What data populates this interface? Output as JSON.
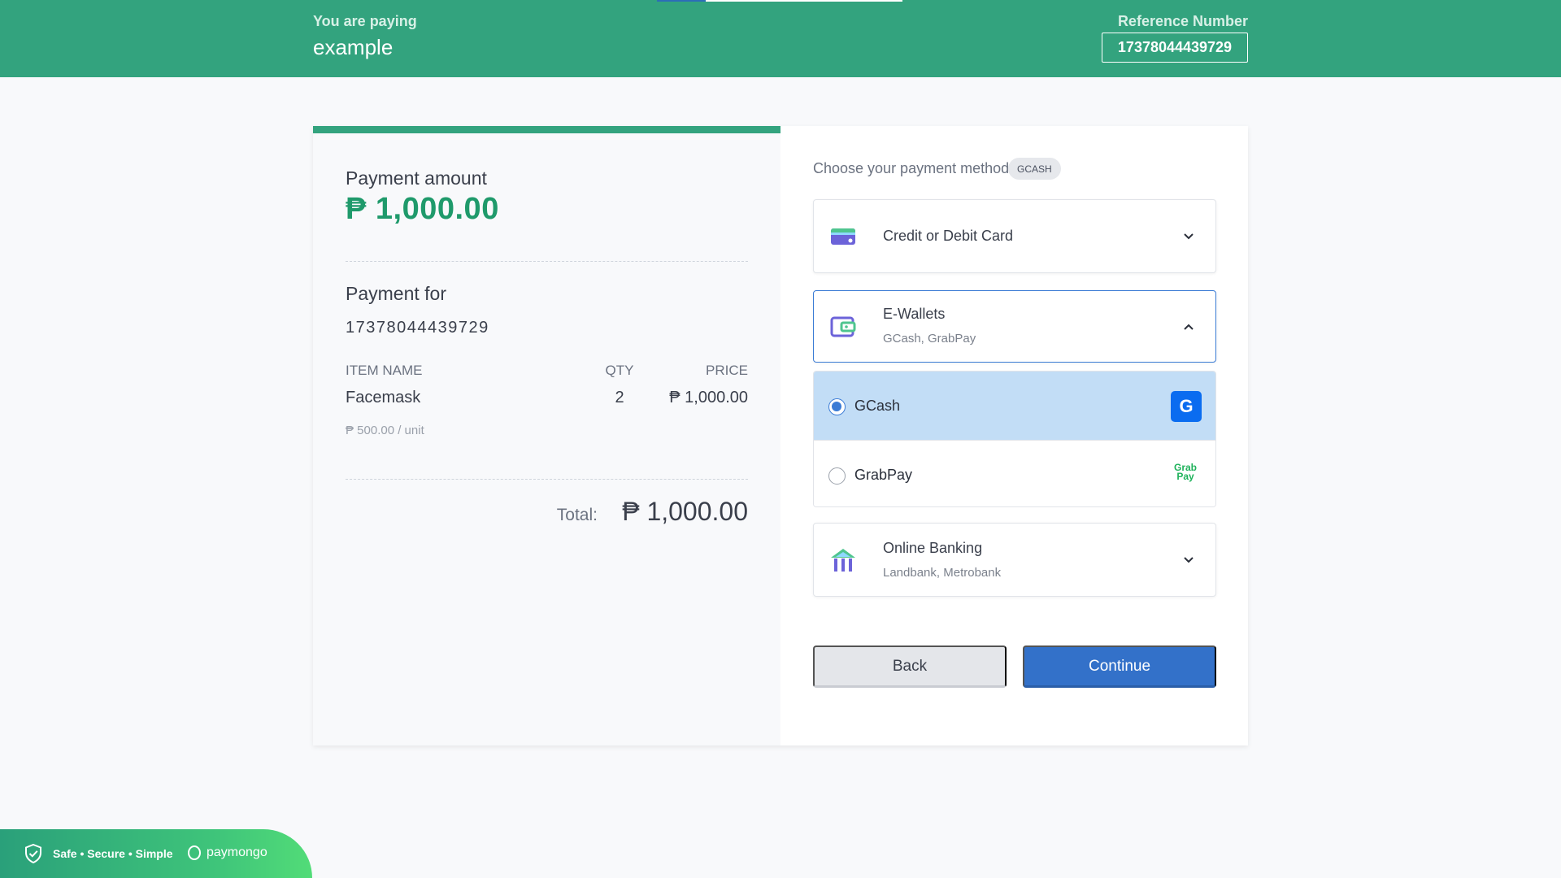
{
  "header": {
    "paying_label": "You are paying",
    "merchant": "example",
    "reference_label": "Reference Number",
    "reference_number": "17378044439729"
  },
  "summary": {
    "amount_label": "Payment amount",
    "amount": "₱ 1,000.00",
    "payment_for_label": "Payment for",
    "payment_for_value": "17378044439729",
    "columns": {
      "item": "ITEM NAME",
      "qty": "QTY",
      "price": "PRICE"
    },
    "items": [
      {
        "name": "Facemask",
        "qty": "2",
        "price": "₱ 1,000.00",
        "unit_price": "₱ 500.00 / unit"
      }
    ],
    "total_label": "Total:",
    "total": "₱ 1,000.00"
  },
  "methods": {
    "choose_label": "Choose your payment method",
    "selected_badge": "GCASH",
    "card": {
      "title": "Credit or Debit Card"
    },
    "wallets": {
      "title": "E-Wallets",
      "subtitle": "GCash, GrabPay",
      "options": [
        {
          "name": "GCash",
          "selected": true
        },
        {
          "name": "GrabPay",
          "selected": false
        }
      ],
      "gcash_logo": "G",
      "grab_logo_line1": "Grab",
      "grab_logo_line2": "Pay"
    },
    "banking": {
      "title": "Online Banking",
      "subtitle": "Landbank, Metrobank"
    }
  },
  "buttons": {
    "back": "Back",
    "continue": "Continue"
  },
  "footer": {
    "tagline": "Safe • Secure • Simple",
    "brand": "paymongo"
  },
  "colors": {
    "header_green": "#33a37e",
    "amount_green": "#1f9a6b",
    "selected_blue": "#c2ddf6",
    "primary_button": "#3371c9"
  }
}
